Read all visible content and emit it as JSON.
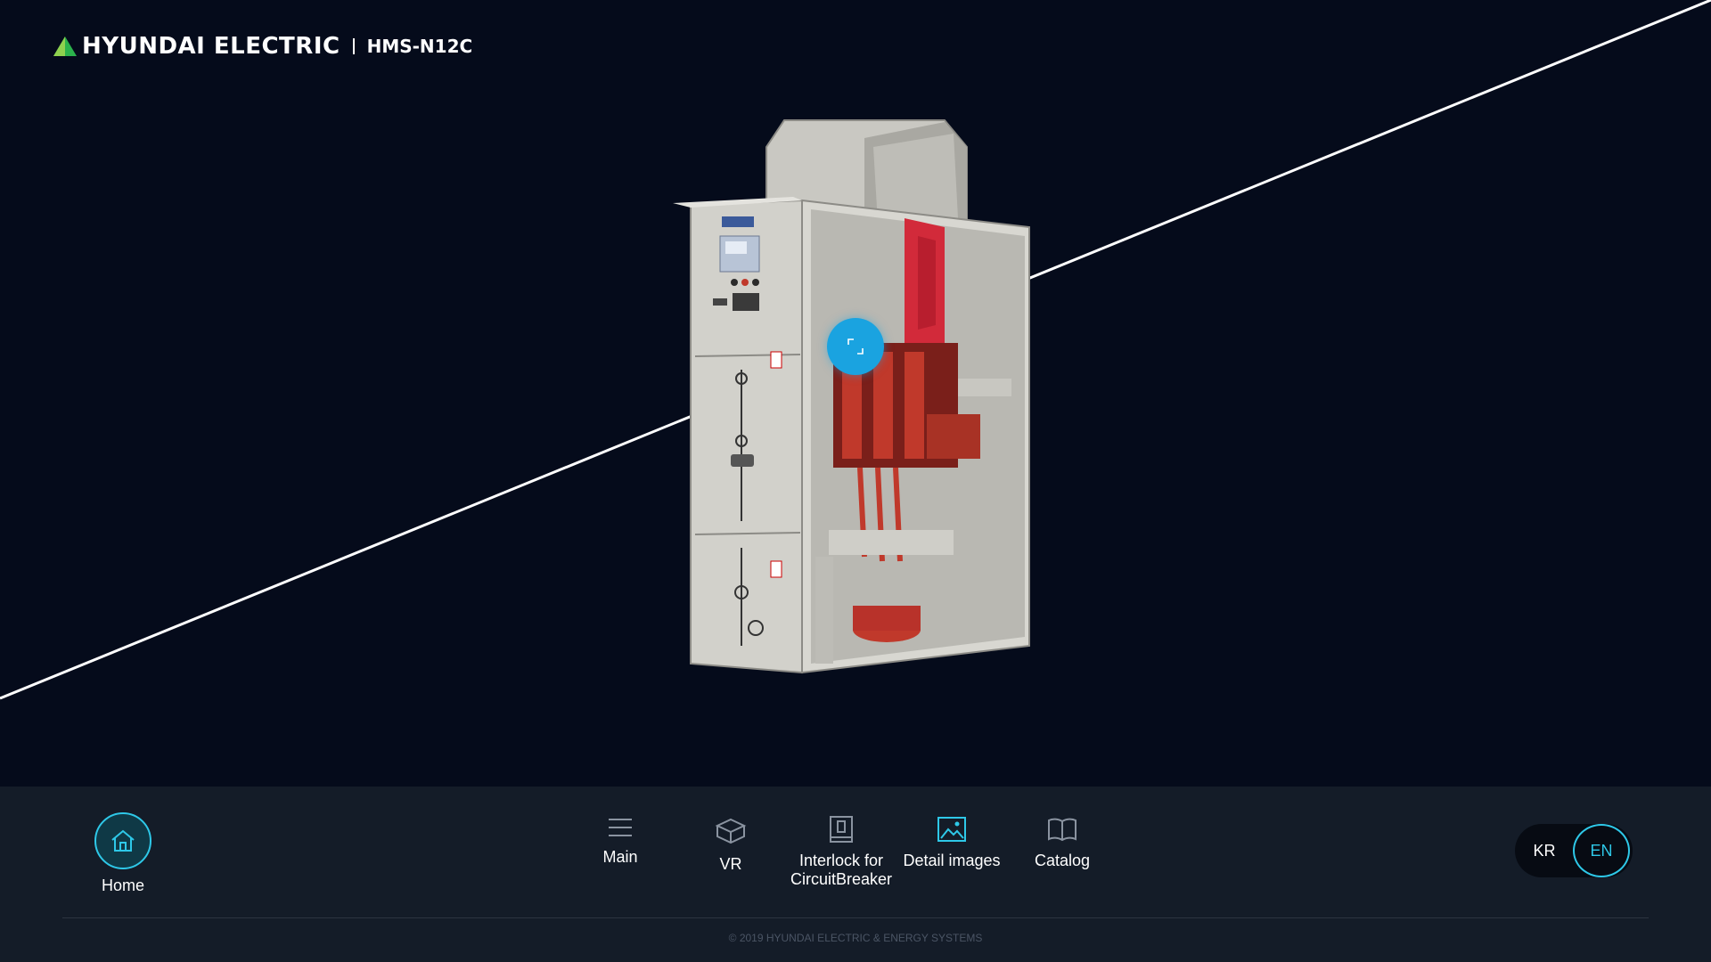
{
  "header": {
    "brand": "HYUNDAI ELECTRIC",
    "model": "HMS-N12C"
  },
  "viewer": {
    "product_image": "switchgear-cabinet-cutaway",
    "hotspot_icon": "scan-icon"
  },
  "footer": {
    "home": {
      "label": "Home",
      "icon": "home-icon"
    },
    "nav": [
      {
        "label": "Main",
        "icon": "menu-icon"
      },
      {
        "label": "VR",
        "icon": "cube-icon"
      },
      {
        "label": "Interlock for CircuitBreaker",
        "icon": "panel-icon"
      },
      {
        "label": "Detail images",
        "icon": "image-icon"
      },
      {
        "label": "Catalog",
        "icon": "book-icon"
      }
    ],
    "lang": {
      "kr": "KR",
      "en": "EN",
      "active": "EN"
    },
    "copyright": "© 2019 HYUNDAI ELECTRIC & ENERGY SYSTEMS"
  },
  "colors": {
    "background": "#050b1b",
    "footer": "#141c28",
    "accent": "#2ec8e8",
    "hotspot": "#1aa3e0",
    "logo_green": "#2bb24c"
  }
}
